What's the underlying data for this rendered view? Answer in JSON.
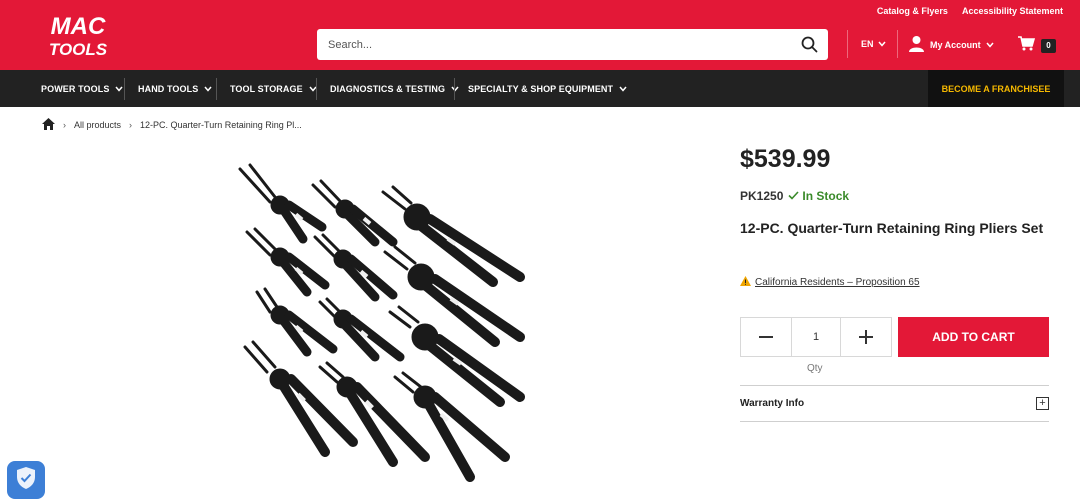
{
  "header": {
    "brand_top": "MAC",
    "brand_bottom": "TOOLS",
    "util_links": [
      "Catalog & Flyers",
      "Accessibility Statement"
    ],
    "search_placeholder": "Search...",
    "language": "EN",
    "account_label": "My Account",
    "cart_count": "0"
  },
  "nav": {
    "items": [
      "POWER TOOLS",
      "HAND TOOLS",
      "TOOL STORAGE",
      "DIAGNOSTICS & TESTING",
      "SPECIALTY & SHOP EQUIPMENT"
    ],
    "franchise_label": "BECOME A FRANCHISEE"
  },
  "breadcrumb": {
    "items": [
      "All products",
      "12-PC. Quarter-Turn Retaining Ring Pl..."
    ]
  },
  "product": {
    "price": "$539.99",
    "sku": "PK1250",
    "stock_status": "In Stock",
    "title": "12-PC. Quarter-Turn Retaining Ring Pliers Set",
    "prop65_label": "California Residents – Proposition 65",
    "quantity": "1",
    "qty_label": "Qty",
    "add_to_cart_label": "ADD TO CART",
    "warranty_label": "Warranty Info"
  },
  "colors": {
    "brand_red": "#e31837",
    "nav_dark": "#222222",
    "franchise_yellow": "#f5b800",
    "stock_green": "#3a8a2a"
  },
  "icons": {
    "search": "search-icon",
    "account": "user-icon",
    "cart": "cart-icon",
    "home": "home-icon",
    "warning": "warning-icon",
    "check": "check-icon",
    "shield": "shield-icon"
  }
}
